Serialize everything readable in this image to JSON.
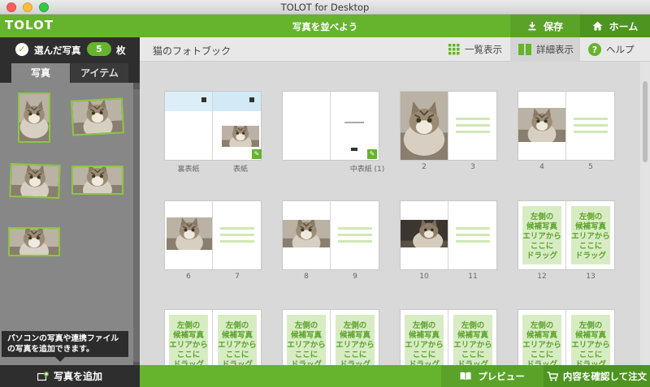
{
  "window": {
    "title": "TOLOT for Desktop"
  },
  "header": {
    "logo": "TOLOT",
    "title": "写真を並べよう",
    "save_label": "保存",
    "home_label": "ホーム"
  },
  "sidebar": {
    "selected_label": "選んだ写真",
    "count": "5",
    "count_unit": "枚",
    "tabs": [
      {
        "label": "写真",
        "active": true
      },
      {
        "label": "アイテム",
        "active": false
      }
    ],
    "tooltip_line1": "パソコンの写真や連携ファイル",
    "tooltip_line2": "の写真を追加できます。",
    "add_button": "写真を追加"
  },
  "toolbar": {
    "book_title": "猫のフォトブック",
    "list_view": "一覧表示",
    "detail_view": "詳細表示",
    "help": "ヘルプ"
  },
  "pages": {
    "back_cover": "裏表紙",
    "cover": "表紙",
    "inner_cover": "中表紙 (1)",
    "n2": "2",
    "n3": "3",
    "n4": "4",
    "n5": "5",
    "n6": "6",
    "n7": "7",
    "n8": "8",
    "n9": "9",
    "n10": "10",
    "n11": "11",
    "n12": "12",
    "n13": "13"
  },
  "drop_hint": {
    "l1": "左側の",
    "l2": "候補写真",
    "l3": "エリアから",
    "l4": "ここに",
    "l5": "ドラッグ"
  },
  "bottom": {
    "preview": "プレビュー",
    "order": "内容を確認して注文"
  },
  "colors": {
    "brand_green": "#66b32e",
    "dark_panel": "#2e2e2e",
    "drop_zone": "#d8ecc4"
  },
  "icons": {
    "check": "check-circle-icon",
    "save": "download-icon",
    "home": "home-icon",
    "list": "grid-icon",
    "detail": "detail-view-icon",
    "help": "help-icon",
    "add": "add-photo-icon",
    "preview": "book-icon",
    "order": "cart-icon"
  }
}
